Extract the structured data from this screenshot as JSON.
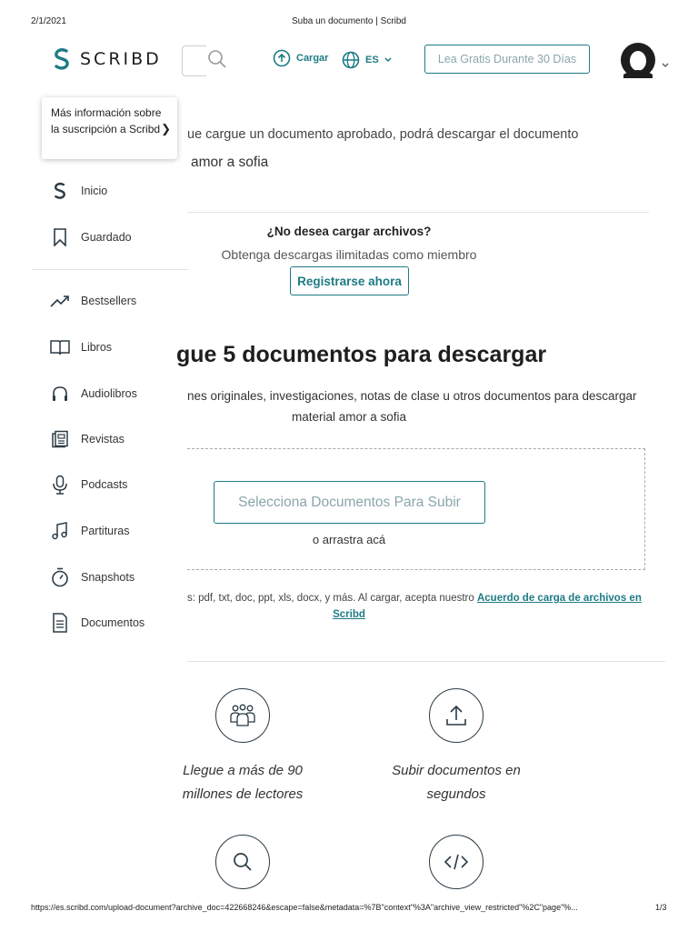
{
  "print_header": {
    "date": "2/1/2021",
    "title": "Suba un documento | Scribd"
  },
  "header": {
    "logo_text": "SCRIBD",
    "upload_label": "Cargar",
    "lang_label": "ES",
    "trial_label": "Lea Gratis Durante 30 Días"
  },
  "sidebar": {
    "promo_text": "Más información sobre la suscripción a Scribd",
    "items": [
      {
        "label": "Inicio",
        "icon": "scribd-s-icon"
      },
      {
        "label": "Guardado",
        "icon": "bookmark-icon"
      },
      {
        "label": "Bestsellers",
        "icon": "trending-up-icon"
      },
      {
        "label": "Libros",
        "icon": "book-icon"
      },
      {
        "label": "Audiolibros",
        "icon": "headphones-icon"
      },
      {
        "label": "Revistas",
        "icon": "magazine-icon"
      },
      {
        "label": "Podcasts",
        "icon": "microphone-icon"
      },
      {
        "label": "Partituras",
        "icon": "music-note-icon"
      },
      {
        "label": "Snapshots",
        "icon": "stopwatch-icon"
      },
      {
        "label": "Documentos",
        "icon": "document-icon"
      }
    ]
  },
  "main": {
    "doc_note": "ue cargue un documento aprobado, podrá descargar el documento",
    "doc_title": "amor a sofia",
    "no_upload_question": "¿No desea cargar archivos?",
    "no_upload_sub": "Obtenga descargas ilimitadas como miembro",
    "signup_label": "Registrarse ahora",
    "upload_heading": "gue 5 documentos para descargar",
    "upload_desc_line1": "nes originales, investigaciones, notas de clase u otros documentos para descargar",
    "upload_desc_line2": "material amor a sofia",
    "select_label": "Selecciona Documentos Para Subir",
    "drag_text": "o arrastra acá",
    "formats_text": "s: pdf, txt, doc, ppt, xls, docx, y más. Al cargar, acepta nuestro ",
    "formats_link1": "Acuerdo de carga de archivos en",
    "formats_link2": "Scribd",
    "feature1_line1": "Llegue a más de 90",
    "feature1_line2": "millones de lectores",
    "feature2_line1": "Subir documentos en",
    "feature2_line2": "segundos"
  },
  "footer": {
    "url": "https://es.scribd.com/upload-document?archive_doc=422668246&escape=false&metadata=%7B\"context\"%3A\"archive_view_restricted\"%2C\"page\"%...",
    "page": "1/3"
  }
}
